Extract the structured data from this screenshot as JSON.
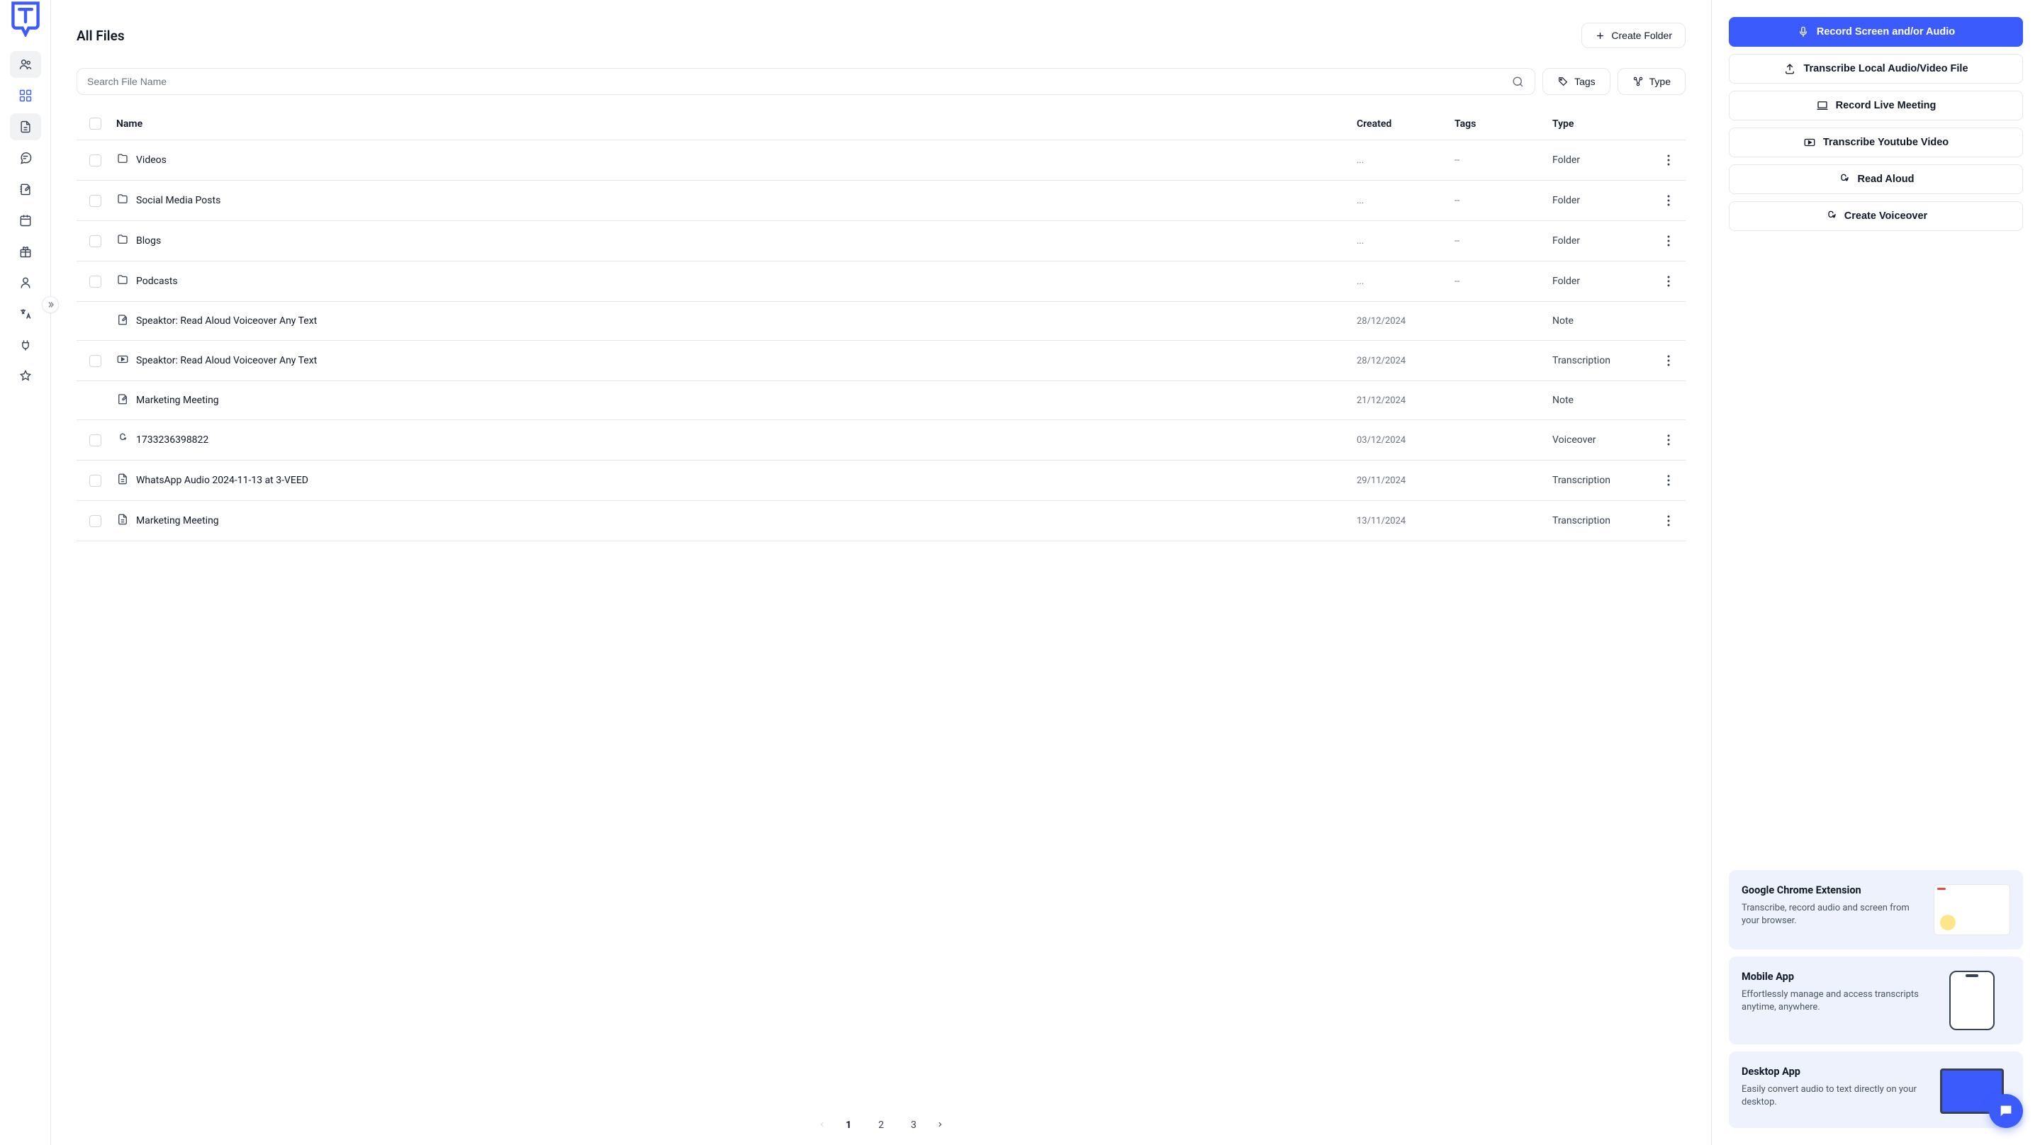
{
  "page": {
    "title": "All Files"
  },
  "buttons": {
    "create_folder": "Create Folder"
  },
  "search": {
    "placeholder": "Search File Name"
  },
  "filters": {
    "tags": "Tags",
    "type": "Type"
  },
  "table": {
    "headers": {
      "name": "Name",
      "created": "Created",
      "tags": "Tags",
      "type": "Type"
    },
    "rows": [
      {
        "name": "Videos",
        "created": "...",
        "tags": "--",
        "type": "Folder",
        "icon": "folder",
        "checkbox": true,
        "more": true
      },
      {
        "name": "Social Media Posts",
        "created": "...",
        "tags": "--",
        "type": "Folder",
        "icon": "folder",
        "checkbox": true,
        "more": true
      },
      {
        "name": "Blogs",
        "created": "...",
        "tags": "--",
        "type": "Folder",
        "icon": "folder",
        "checkbox": true,
        "more": true
      },
      {
        "name": "Podcasts",
        "created": "...",
        "tags": "--",
        "type": "Folder",
        "icon": "folder",
        "checkbox": true,
        "more": true
      },
      {
        "name": "Speaktor: Read Aloud Voiceover Any Text",
        "created": "28/12/2024",
        "tags": "",
        "type": "Note",
        "icon": "note",
        "checkbox": false,
        "more": false
      },
      {
        "name": "Speaktor: Read Aloud Voiceover Any Text",
        "created": "28/12/2024",
        "tags": "",
        "type": "Transcription",
        "icon": "video",
        "checkbox": true,
        "more": true
      },
      {
        "name": "Marketing Meeting",
        "created": "21/12/2024",
        "tags": "",
        "type": "Note",
        "icon": "note",
        "checkbox": false,
        "more": false
      },
      {
        "name": "1733236398822",
        "created": "03/12/2024",
        "tags": "",
        "type": "Voiceover",
        "icon": "voice",
        "checkbox": true,
        "more": true
      },
      {
        "name": "WhatsApp Audio 2024-11-13 at 3-VEED",
        "created": "29/11/2024",
        "tags": "",
        "type": "Transcription",
        "icon": "doc",
        "checkbox": true,
        "more": true
      },
      {
        "name": "Marketing Meeting",
        "created": "13/11/2024",
        "tags": "",
        "type": "Transcription",
        "icon": "doc",
        "checkbox": true,
        "more": true
      }
    ]
  },
  "pagination": {
    "pages": [
      "1",
      "2",
      "3"
    ],
    "active": "1"
  },
  "actions": {
    "record_screen": "Record Screen and/or Audio",
    "transcribe_local": "Transcribe Local Audio/Video File",
    "record_meeting": "Record Live Meeting",
    "transcribe_youtube": "Transcribe Youtube Video",
    "read_aloud": "Read Aloud",
    "create_voiceover": "Create Voiceover"
  },
  "promos": [
    {
      "title": "Google Chrome Extension",
      "desc": "Transcribe, record audio and screen from your browser.",
      "img": "browser"
    },
    {
      "title": "Mobile App",
      "desc": "Effortlessly manage and access transcripts anytime, anywhere.",
      "img": "phone"
    },
    {
      "title": "Desktop App",
      "desc": "Easily convert audio to text directly on your desktop.",
      "img": "laptop"
    }
  ]
}
